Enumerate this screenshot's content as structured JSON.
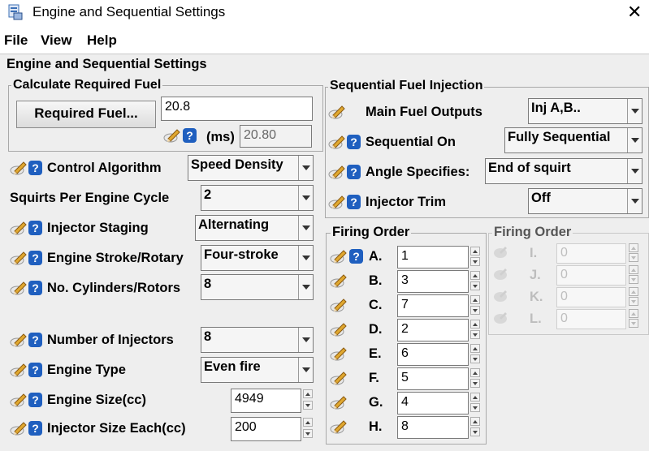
{
  "window": {
    "title": "Engine and Sequential Settings"
  },
  "menu": {
    "file": "File",
    "view": "View",
    "help": "Help"
  },
  "panel": {
    "title": "Engine and Sequential Settings"
  },
  "calc": {
    "group_title": "Calculate Required Fuel",
    "button_label": "Required Fuel...",
    "value": "20.8",
    "ms_label": "(ms)",
    "ms_value": "20.80"
  },
  "engine": [
    {
      "label": "Control Algorithm",
      "value": "Speed Density"
    },
    {
      "label": "Squirts Per Engine Cycle",
      "value": "2"
    },
    {
      "label": "Injector Staging",
      "value": "Alternating"
    },
    {
      "label": "Engine Stroke/Rotary",
      "value": "Four-stroke"
    },
    {
      "label": "No. Cylinders/Rotors",
      "value": "8"
    },
    {
      "label": "Number of Injectors",
      "value": "8"
    },
    {
      "label": "Engine Type",
      "value": "Even fire"
    },
    {
      "label": "Engine Size(cc)",
      "value": "4949"
    },
    {
      "label": "Injector Size Each(cc)",
      "value": "200"
    }
  ],
  "seq": {
    "group_title": "Sequential Fuel Injection",
    "rows": [
      {
        "label": "Main Fuel Outputs",
        "value": "Inj A,B.."
      },
      {
        "label": "Sequential On",
        "value": "Fully Sequential"
      },
      {
        "label": "Angle Specifies:",
        "value": "End of squirt"
      },
      {
        "label": "Injector Trim",
        "value": "Off"
      }
    ]
  },
  "firing1": {
    "group_title": "Firing Order",
    "rows": [
      {
        "label": "A.",
        "value": "1"
      },
      {
        "label": "B.",
        "value": "3"
      },
      {
        "label": "C.",
        "value": "7"
      },
      {
        "label": "D.",
        "value": "2"
      },
      {
        "label": "E.",
        "value": "6"
      },
      {
        "label": "F.",
        "value": "5"
      },
      {
        "label": "G.",
        "value": "4"
      },
      {
        "label": "H.",
        "value": "8"
      }
    ]
  },
  "firing2": {
    "group_title": "Firing Order",
    "rows": [
      {
        "label": "I.",
        "value": "0"
      },
      {
        "label": "J.",
        "value": "0"
      },
      {
        "label": "K.",
        "value": "0"
      },
      {
        "label": "L.",
        "value": "0"
      }
    ]
  },
  "colors": {
    "help_icon": "#1f5fbf",
    "panel_bg": "#eeeeee"
  }
}
